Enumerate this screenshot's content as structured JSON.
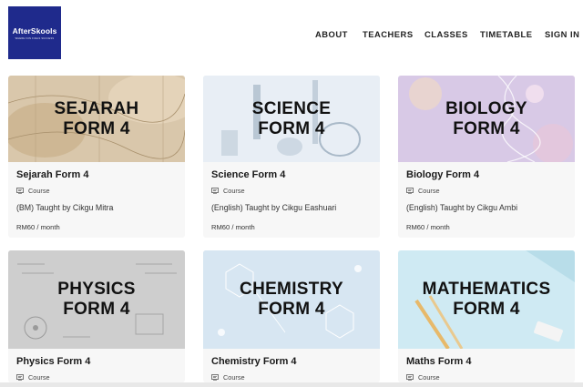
{
  "brand": {
    "name": "AfterSkools",
    "tagline": "WHERE FUN FUELS SUCCESS",
    "color": "#1f2a8c"
  },
  "nav": [
    "ABOUT",
    "TEACHERS",
    "CLASSES",
    "TIMETABLE",
    "SIGN IN"
  ],
  "courses": [
    {
      "image_line1": "SEJARAH",
      "image_line2": "FORM 4",
      "title": "Sejarah Form 4",
      "type": "Course",
      "description": "(BM) Taught by Cikgu Mitra",
      "price": "RM60 / month"
    },
    {
      "image_line1": "SCIENCE",
      "image_line2": "FORM 4",
      "title": "Science Form 4",
      "type": "Course",
      "description": "(English) Taught by Cikgu Eashuari",
      "price": "RM60 / month"
    },
    {
      "image_line1": "BIOLOGY",
      "image_line2": "FORM 4",
      "title": "Biology Form 4",
      "type": "Course",
      "description": "(English) Taught by Cikgu Ambi",
      "price": "RM60 / month"
    },
    {
      "image_line1": "PHYSICS",
      "image_line2": "FORM 4",
      "title": "Physics Form 4",
      "type": "Course"
    },
    {
      "image_line1": "CHEMISTRY",
      "image_line2": "FORM 4",
      "title": "Chemistry Form 4",
      "type": "Course"
    },
    {
      "image_line1": "MATHEMATICS",
      "image_line2": "FORM 4",
      "title": "Maths Form 4",
      "type": "Course"
    }
  ]
}
